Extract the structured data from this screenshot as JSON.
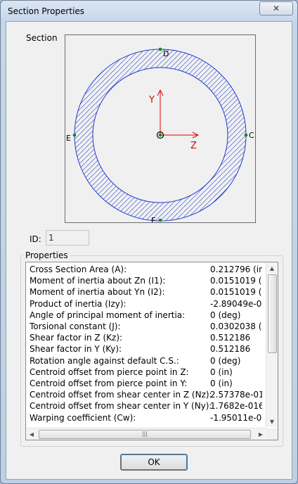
{
  "window": {
    "title": "Section Properties",
    "close_glyph": "✕"
  },
  "section": {
    "label": "Section",
    "axis_y": "Y",
    "axis_z": "Z",
    "point_d": "D",
    "point_e": "E",
    "point_c": "C",
    "point_f": "F",
    "hatch_color": "#1f3ccf",
    "axis_color": "#e00000"
  },
  "id": {
    "label": "ID:",
    "value": "1"
  },
  "properties": {
    "label": "Properties",
    "rows": [
      {
        "name": "Cross Section Area (A):",
        "value": "0.212796 (in"
      },
      {
        "name": "Moment of inertia about Zn (I1):",
        "value": "0.0151019 (i"
      },
      {
        "name": "Moment of inertia about Yn (I2):",
        "value": "0.0151019 (i"
      },
      {
        "name": "Product of inertia (Izy):",
        "value": "-2.89049e-0"
      },
      {
        "name": "Angle of principal moment of inertia:",
        "value": "0 (deg)"
      },
      {
        "name": "Torsional constant (J):",
        "value": "0.0302038 (i"
      },
      {
        "name": "Shear factor in Z (Kz):",
        "value": "0.512186"
      },
      {
        "name": "Shear factor in Y (Ky):",
        "value": "0.512186"
      },
      {
        "name": "Rotation angle against default C.S.:",
        "value": "0 (deg)"
      },
      {
        "name": "Centroid offset from pierce point in Z:",
        "value": "0 (in)"
      },
      {
        "name": "Centroid offset from pierce point in Y:",
        "value": "0 (in)"
      },
      {
        "name": "Centroid offset from shear center in Z (Nz):",
        "value": "2.57378e-01"
      },
      {
        "name": "Centroid offset from shear center in Y (Ny):",
        "value": "1.7682e-016"
      },
      {
        "name": "Warping coefficient (Cw):",
        "value": "-1.95011e-0"
      }
    ]
  },
  "scrollbar": {
    "up": "▲",
    "down": "▼",
    "left": "◀",
    "right": "▶",
    "grip": "|||"
  },
  "buttons": {
    "ok": "OK"
  }
}
